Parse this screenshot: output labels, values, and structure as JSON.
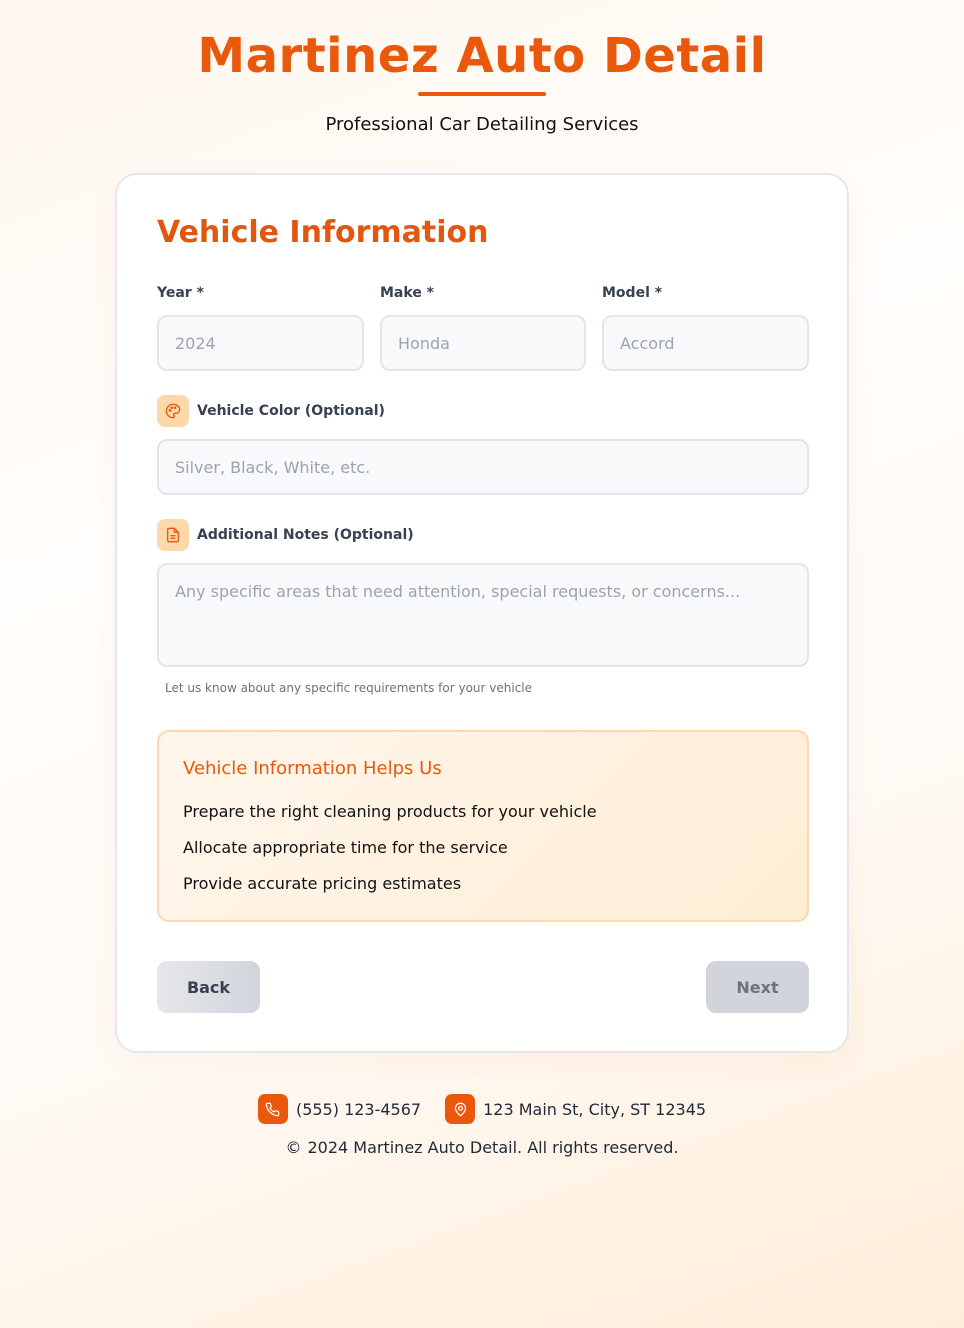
{
  "header": {
    "brand": "Martinez Auto Detail",
    "tagline": "Professional Car Detailing Services"
  },
  "form": {
    "title": "Vehicle Information",
    "year": {
      "label": "Year *",
      "placeholder": "2024",
      "value": ""
    },
    "make": {
      "label": "Make *",
      "placeholder": "Honda",
      "value": ""
    },
    "model": {
      "label": "Model *",
      "placeholder": "Accord",
      "value": ""
    },
    "color": {
      "label": "Vehicle Color (Optional)",
      "placeholder": "Silver, Black, White, etc.",
      "icon": "palette-icon"
    },
    "notes": {
      "label": "Additional Notes (Optional)",
      "placeholder": "Any specific areas that need attention, special requests, or concerns...",
      "hint": "Let us know about any specific requirements for your vehicle",
      "icon": "document-icon"
    }
  },
  "info": {
    "title": "Vehicle Information Helps Us",
    "items": [
      "Prepare the right cleaning products for your vehicle",
      "Allocate appropriate time for the service",
      "Provide accurate pricing estimates"
    ]
  },
  "buttons": {
    "back": "Back",
    "next": "Next"
  },
  "footer": {
    "phone": "(555) 123-4567",
    "address": "123 Main St, City, ST 12345",
    "copyright_symbol": "©",
    "copyright": "2024 Martinez Auto Detail. All rights reserved."
  },
  "colors": {
    "accent": "#ea580c",
    "accent_light": "#fed7aa"
  }
}
